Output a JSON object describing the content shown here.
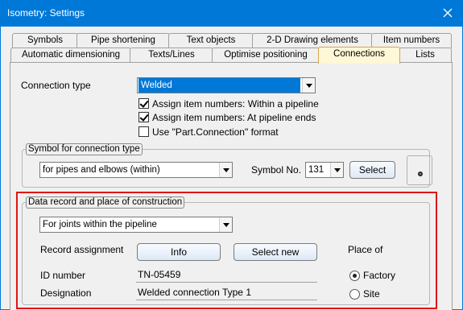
{
  "window": {
    "title": "Isometry: Settings",
    "close_icon": "close-icon",
    "accent": "#0078d7"
  },
  "tabs_row1": [
    {
      "label": "Symbols"
    },
    {
      "label": "Pipe shortening"
    },
    {
      "label": "Text objects"
    },
    {
      "label": "2-D Drawing elements"
    },
    {
      "label": "Item numbers"
    }
  ],
  "tabs_row2": [
    {
      "label": "Automatic dimensioning"
    },
    {
      "label": "Texts/Lines"
    },
    {
      "label": "Optimise positioning"
    },
    {
      "label": "Connections",
      "active": true
    },
    {
      "label": "Lists"
    }
  ],
  "connection": {
    "label": "Connection type",
    "value": "Welded",
    "checkboxes": [
      {
        "label": "Assign item numbers: Within a pipeline",
        "checked": true
      },
      {
        "label": "Assign item numbers: At pipeline ends",
        "checked": true
      },
      {
        "label": "Use \"Part.Connection\" format",
        "checked": false
      }
    ]
  },
  "symbol_group": {
    "title": "Symbol for connection type",
    "combo_value": "for pipes and elbows (within)",
    "symbol_no_label": "Symbol No.",
    "symbol_no_value": "131",
    "select_button": "Select",
    "preview_icon": "dot-symbol-icon"
  },
  "data_group": {
    "title": "Data record and place of construction",
    "combo_value": "For joints within the pipeline",
    "record_assignment_label": "Record assignment",
    "info_button": "Info",
    "select_new_button": "Select new",
    "place_of_label": "Place of",
    "id_label": "ID number",
    "id_value": "TN-05459",
    "designation_label": "Designation",
    "designation_value": "Welded connection Type 1",
    "places": [
      {
        "label": "Factory",
        "selected": true
      },
      {
        "label": "Site",
        "selected": false
      }
    ]
  }
}
